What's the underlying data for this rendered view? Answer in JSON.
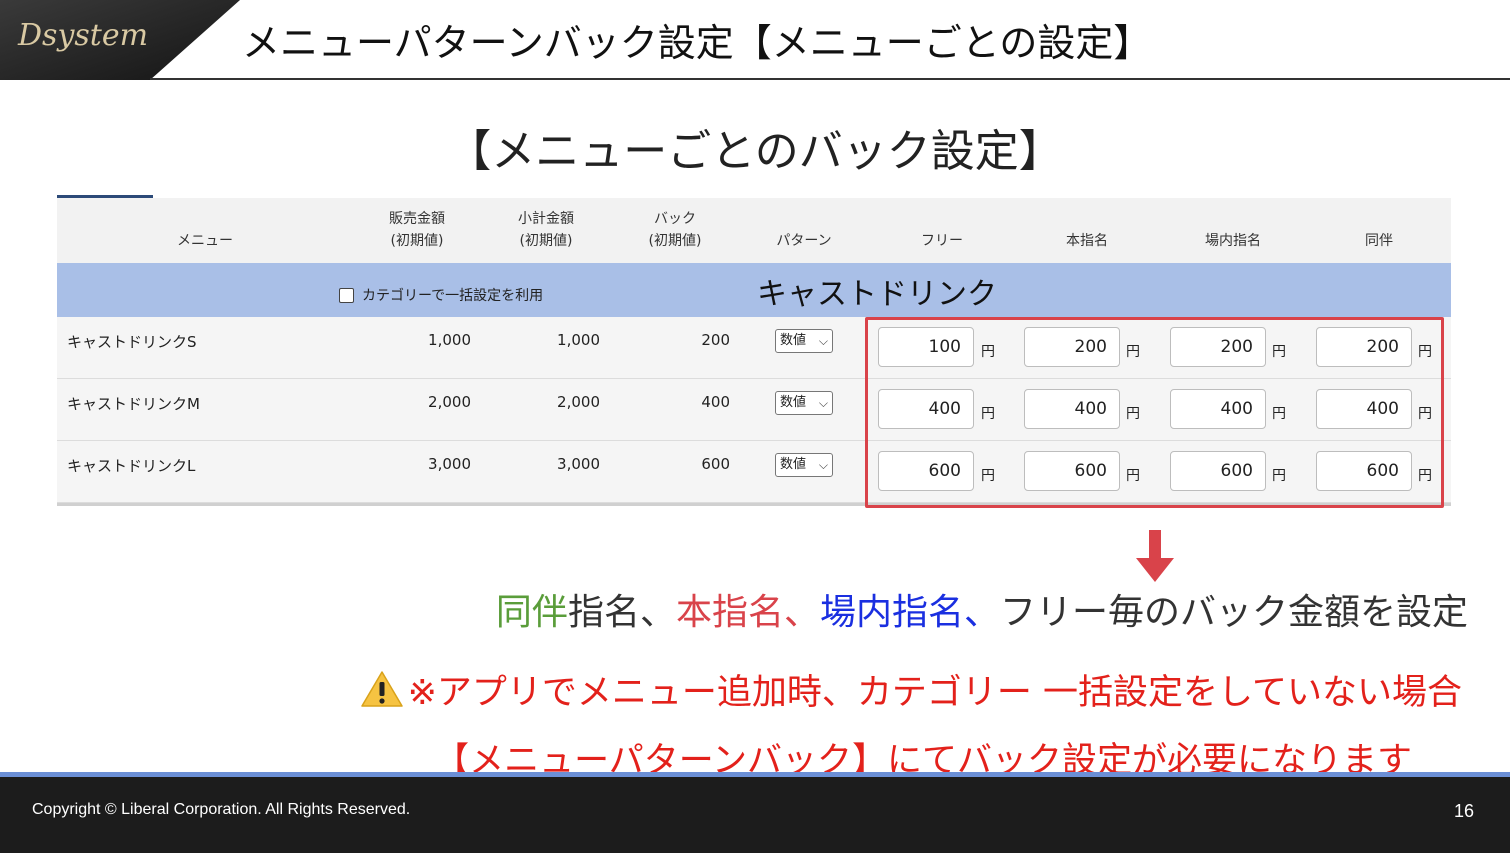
{
  "header": {
    "logo_text": "Dsystem",
    "title": "メニューパターンバック設定【メニューごとの設定】"
  },
  "section_title": "【メニューごとのバック設定】",
  "table": {
    "headers": {
      "menu": "メニュー",
      "sale_price_1": "販売金額",
      "sale_price_2": "(初期値)",
      "subtotal_1": "小計金額",
      "subtotal_2": "(初期値)",
      "back_1": "バック",
      "back_2": "(初期値)",
      "pattern": "パターン",
      "free": "フリー",
      "hon_shimei": "本指名",
      "jonai_shimei": "場内指名",
      "dohan": "同伴"
    },
    "category": {
      "title": "キャストドリンク",
      "checkbox_label": "カテゴリーで一括設定を利用",
      "checked": false
    },
    "yen_label": "円",
    "rows": [
      {
        "name": "キャストドリンクS",
        "sale": "1,000",
        "subtotal": "1,000",
        "back": "200",
        "pattern": "数値",
        "free": "100",
        "hon": "200",
        "jonai": "200",
        "dohan": "200"
      },
      {
        "name": "キャストドリンクM",
        "sale": "2,000",
        "subtotal": "2,000",
        "back": "400",
        "pattern": "数値",
        "free": "400",
        "hon": "400",
        "jonai": "400",
        "dohan": "400"
      },
      {
        "name": "キャストドリンクL",
        "sale": "3,000",
        "subtotal": "3,000",
        "back": "600",
        "pattern": "数値",
        "free": "600",
        "hon": "600",
        "jonai": "600",
        "dohan": "600"
      }
    ]
  },
  "description": {
    "part1": "同伴",
    "part2": "指名、",
    "part3": "本指名、",
    "part4": "場内指名、",
    "part5": "フリー毎のバック金額を設定"
  },
  "warning": {
    "line1": "※アプリでメニュー追加時、カテゴリー 一括設定をしていない場合",
    "line2": "【メニューパターンバック】にてバック設定が必要になります"
  },
  "footer": {
    "copyright": "Copyright ©  Liberal Corporation. All Rights Reserved.",
    "page_number": "16"
  },
  "colors": {
    "category_bar": "#a9bfe7",
    "highlight_border": "#d9434a",
    "warning_text": "#e3211b",
    "green": "#5a9d3a",
    "blue": "#1a2fe0",
    "footer_bg": "#1c1c1c",
    "footer_line": "#6b8fd6"
  }
}
